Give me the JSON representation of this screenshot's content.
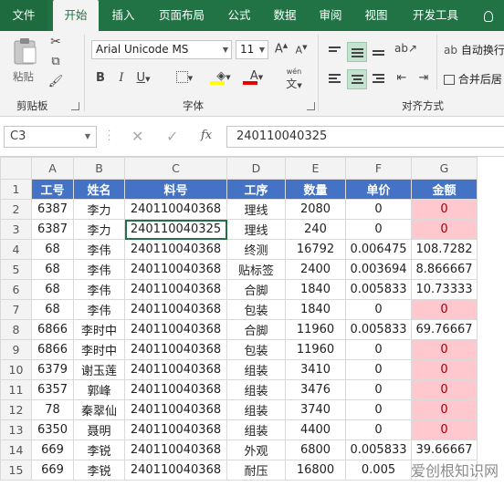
{
  "tabs": [
    "文件",
    "开始",
    "插入",
    "页面布局",
    "公式",
    "数据",
    "审阅",
    "视图",
    "开发工具"
  ],
  "ribbon": {
    "paste_label": "粘贴",
    "clipboard_group": "剪贴板",
    "font_name": "Arial Unicode MS",
    "font_size": "11",
    "grow_font": "A",
    "shrink_font": "A",
    "bold": "B",
    "italic": "I",
    "underline": "U",
    "font_color_glyph": "A",
    "phonetic": "wén",
    "font_group": "字体",
    "wrap_text": "自动换行",
    "merge_center": "合并后居",
    "align_group": "对齐方式"
  },
  "formula_bar": {
    "name_box": "C3",
    "fx": "fx",
    "formula": "240110040325"
  },
  "columns": [
    "A",
    "B",
    "C",
    "D",
    "E",
    "F",
    "G"
  ],
  "rows": [
    {
      "n": "1",
      "cells": [
        "工号",
        "姓名",
        "料号",
        "工序",
        "数量",
        "单价",
        "金额"
      ]
    },
    {
      "n": "2",
      "cells": [
        "6387",
        "李力",
        "240110040368",
        "理线",
        "2080",
        "0",
        "0"
      ]
    },
    {
      "n": "3",
      "cells": [
        "6387",
        "李力",
        "240110040325",
        "理线",
        "240",
        "0",
        "0"
      ]
    },
    {
      "n": "4",
      "cells": [
        "68",
        "李伟",
        "240110040368",
        "终测",
        "16792",
        "0.006475",
        "108.7282"
      ]
    },
    {
      "n": "5",
      "cells": [
        "68",
        "李伟",
        "240110040368",
        "贴标签",
        "2400",
        "0.003694",
        "8.866667"
      ]
    },
    {
      "n": "6",
      "cells": [
        "68",
        "李伟",
        "240110040368",
        "合脚",
        "1840",
        "0.005833",
        "10.73333"
      ]
    },
    {
      "n": "7",
      "cells": [
        "68",
        "李伟",
        "240110040368",
        "包装",
        "1840",
        "0",
        "0"
      ]
    },
    {
      "n": "8",
      "cells": [
        "6866",
        "李时中",
        "240110040368",
        "合脚",
        "11960",
        "0.005833",
        "69.76667"
      ]
    },
    {
      "n": "9",
      "cells": [
        "6866",
        "李时中",
        "240110040368",
        "包装",
        "11960",
        "0",
        "0"
      ]
    },
    {
      "n": "10",
      "cells": [
        "6379",
        "谢玉莲",
        "240110040368",
        "组装",
        "3410",
        "0",
        "0"
      ]
    },
    {
      "n": "11",
      "cells": [
        "6357",
        "郭峰",
        "240110040368",
        "组装",
        "3476",
        "0",
        "0"
      ]
    },
    {
      "n": "12",
      "cells": [
        "78",
        "秦翠仙",
        "240110040368",
        "组装",
        "3740",
        "0",
        "0"
      ]
    },
    {
      "n": "13",
      "cells": [
        "6350",
        "聂明",
        "240110040368",
        "组装",
        "4400",
        "0",
        "0"
      ]
    },
    {
      "n": "14",
      "cells": [
        "669",
        "李锐",
        "240110040368",
        "外观",
        "6800",
        "0.005833",
        "39.66667"
      ]
    },
    {
      "n": "15",
      "cells": [
        "669",
        "李锐",
        "240110040368",
        "耐压",
        "16800",
        "0.005",
        ""
      ]
    }
  ],
  "watermark": "爱创根知识网",
  "colors": {
    "header_fill": "#4472c4",
    "zero_highlight": "#ffc7ce",
    "ribbon_green": "#217346"
  }
}
